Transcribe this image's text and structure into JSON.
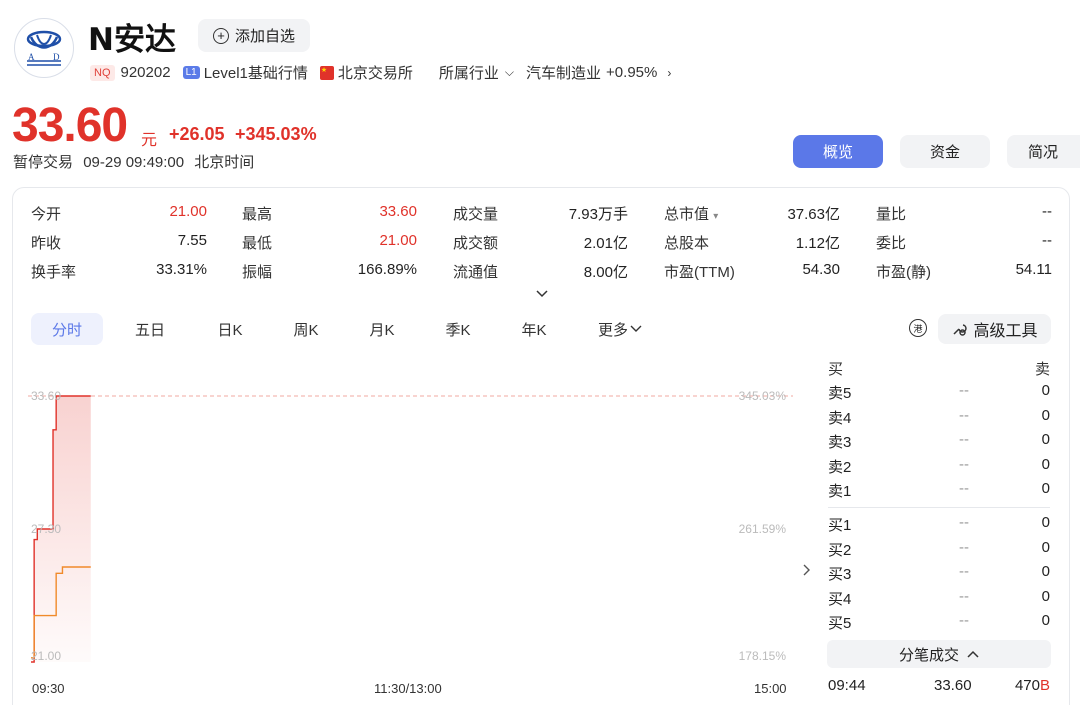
{
  "header": {
    "logo_text": "A D",
    "name": "N安达",
    "add_watchlist": "添加自选",
    "market_tag": "NQ",
    "code": "920202",
    "level_tag": "L1",
    "level": "Level1基础行情",
    "exchange": "北京交易所",
    "industry_label": "所属行业",
    "industry_name": "汽车制造业",
    "industry_change": "+0.95%"
  },
  "quote": {
    "price": "33.60",
    "unit": "元",
    "change": "+26.05",
    "change_pct": "+345.03%",
    "status": "暂停交易",
    "time": "09-29 09:49:00",
    "tz": "北京时间"
  },
  "tabs": {
    "overview": "概览",
    "funds": "资金",
    "brief": "简况"
  },
  "stats": [
    [
      {
        "label": "今开",
        "value": "21.00",
        "color": "red"
      },
      {
        "label": "最高",
        "value": "33.60",
        "color": "red"
      },
      {
        "label": "成交量",
        "value": "7.93万手"
      },
      {
        "label": "总市值",
        "value": "37.63亿",
        "dropdown": "▾"
      },
      {
        "label": "量比",
        "value": "--"
      }
    ],
    [
      {
        "label": "昨收",
        "value": "7.55"
      },
      {
        "label": "最低",
        "value": "21.00",
        "color": "red"
      },
      {
        "label": "成交额",
        "value": "2.01亿"
      },
      {
        "label": "总股本",
        "value": "1.12亿"
      },
      {
        "label": "委比",
        "value": "--"
      }
    ],
    [
      {
        "label": "换手率",
        "value": "33.31%"
      },
      {
        "label": "振幅",
        "value": "166.89%"
      },
      {
        "label": "流通值",
        "value": "8.00亿"
      },
      {
        "label": "市盈(TTM)",
        "value": "54.30"
      },
      {
        "label": "市盈(静)",
        "value": "54.11"
      }
    ]
  ],
  "periods": [
    "分时",
    "五日",
    "日K",
    "周K",
    "月K",
    "季K",
    "年K",
    "更多"
  ],
  "tools": {
    "advanced": "高级工具",
    "icon_text": "港"
  },
  "chart_data": {
    "type": "line",
    "title": "",
    "x_ticks": [
      "09:30",
      "11:30/13:00",
      "15:00"
    ],
    "y_ticks_left": [
      "33.60",
      "27.30",
      "21.00"
    ],
    "y_ticks_right": [
      "345.03%",
      "261.59%",
      "178.15%"
    ],
    "ylim": [
      21.0,
      33.6
    ],
    "series": [
      {
        "name": "",
        "color": "#e0322a",
        "x": [
          "09:30",
          "09:31",
          "09:32",
          "09:36",
          "09:37",
          "09:38",
          "09:40",
          "09:49"
        ],
        "y": [
          21.0,
          26.8,
          27.3,
          27.3,
          32.0,
          33.6,
          33.6,
          33.6
        ]
      },
      {
        "name": "",
        "color": "#f08a2a",
        "x": [
          "09:30",
          "09:31",
          "09:37",
          "09:38",
          "09:40",
          "09:49"
        ],
        "y": [
          21.2,
          23.2,
          23.2,
          25.2,
          25.5,
          25.5
        ]
      }
    ],
    "reference_price": 33.6
  },
  "orderbook": {
    "header_buy": "买",
    "header_sell": "卖",
    "asks": [
      {
        "label": "卖5",
        "price": "--",
        "vol": "0"
      },
      {
        "label": "卖4",
        "price": "--",
        "vol": "0"
      },
      {
        "label": "卖3",
        "price": "--",
        "vol": "0"
      },
      {
        "label": "卖2",
        "price": "--",
        "vol": "0"
      },
      {
        "label": "卖1",
        "price": "--",
        "vol": "0"
      }
    ],
    "bids": [
      {
        "label": "买1",
        "price": "--",
        "vol": "0"
      },
      {
        "label": "买2",
        "price": "--",
        "vol": "0"
      },
      {
        "label": "买3",
        "price": "--",
        "vol": "0"
      },
      {
        "label": "买4",
        "price": "--",
        "vol": "0"
      },
      {
        "label": "买5",
        "price": "--",
        "vol": "0"
      }
    ]
  },
  "trades": {
    "title": "分笔成交",
    "rows": [
      {
        "time": "09:44",
        "price": "33.60",
        "vol": "470",
        "side": "B"
      }
    ]
  }
}
